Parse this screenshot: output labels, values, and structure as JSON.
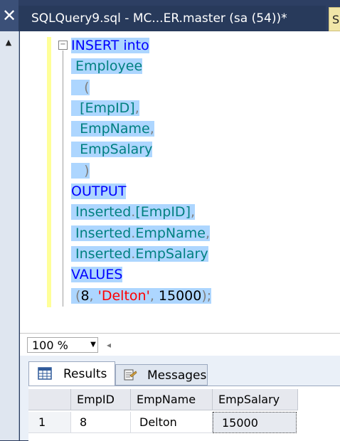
{
  "window": {
    "close_glyph": "✕",
    "doc_tab_title": "SQLQuery9.sql - MC...ER.master (sa (54))*",
    "next_tab_fragment": "S"
  },
  "editor": {
    "collapse_glyph": "−",
    "lines": [
      [
        {
          "t": "INSERT into",
          "c": "kw"
        }
      ],
      [
        {
          "t": " Employee",
          "c": "id"
        }
      ],
      [
        {
          "t": "   (",
          "c": "pn"
        }
      ],
      [
        {
          "t": "  [EmpID]",
          "c": "id"
        },
        {
          "t": ",",
          "c": "pn"
        }
      ],
      [
        {
          "t": "  EmpName",
          "c": "id"
        },
        {
          "t": ",",
          "c": "pn"
        }
      ],
      [
        {
          "t": "  EmpSalary",
          "c": "id"
        }
      ],
      [
        {
          "t": "   )",
          "c": "pn"
        }
      ],
      [
        {
          "t": "OUTPUT",
          "c": "kw"
        }
      ],
      [
        {
          "t": " Inserted",
          "c": "id"
        },
        {
          "t": ".",
          "c": "pn"
        },
        {
          "t": "[EmpID]",
          "c": "id"
        },
        {
          "t": ",",
          "c": "pn"
        }
      ],
      [
        {
          "t": " Inserted",
          "c": "id"
        },
        {
          "t": ".",
          "c": "pn"
        },
        {
          "t": "EmpName",
          "c": "id"
        },
        {
          "t": ",",
          "c": "pn"
        }
      ],
      [
        {
          "t": " Inserted",
          "c": "id"
        },
        {
          "t": ".",
          "c": "pn"
        },
        {
          "t": "EmpSalary",
          "c": "id"
        }
      ],
      [
        {
          "t": "VALUES",
          "c": "kw"
        }
      ],
      [
        {
          "t": " (",
          "c": "pn"
        },
        {
          "t": "8",
          "c": "num"
        },
        {
          "t": ", ",
          "c": "pn"
        },
        {
          "t": "'Delton'",
          "c": "str"
        },
        {
          "t": ", ",
          "c": "pn"
        },
        {
          "t": "15000",
          "c": "num"
        },
        {
          "t": ");",
          "c": "pn"
        }
      ]
    ],
    "colors": {
      "keyword": "#0000ff",
      "identifier": "#008080",
      "punctuation": "#808080",
      "string": "#ff0000",
      "selection": "#add6ff"
    }
  },
  "zoom": {
    "value": "100 %",
    "arrow_glyph": "▼",
    "scroll_glyph": "◂"
  },
  "results": {
    "tabs": [
      {
        "label": "Results",
        "icon": "grid-icon"
      },
      {
        "label": "Messages",
        "icon": "messages-icon"
      }
    ],
    "columns": [
      "EmpID",
      "EmpName",
      "EmpSalary"
    ],
    "rows": [
      {
        "row_number": "1",
        "cells": [
          "8",
          "Delton",
          "15000"
        ]
      }
    ]
  }
}
